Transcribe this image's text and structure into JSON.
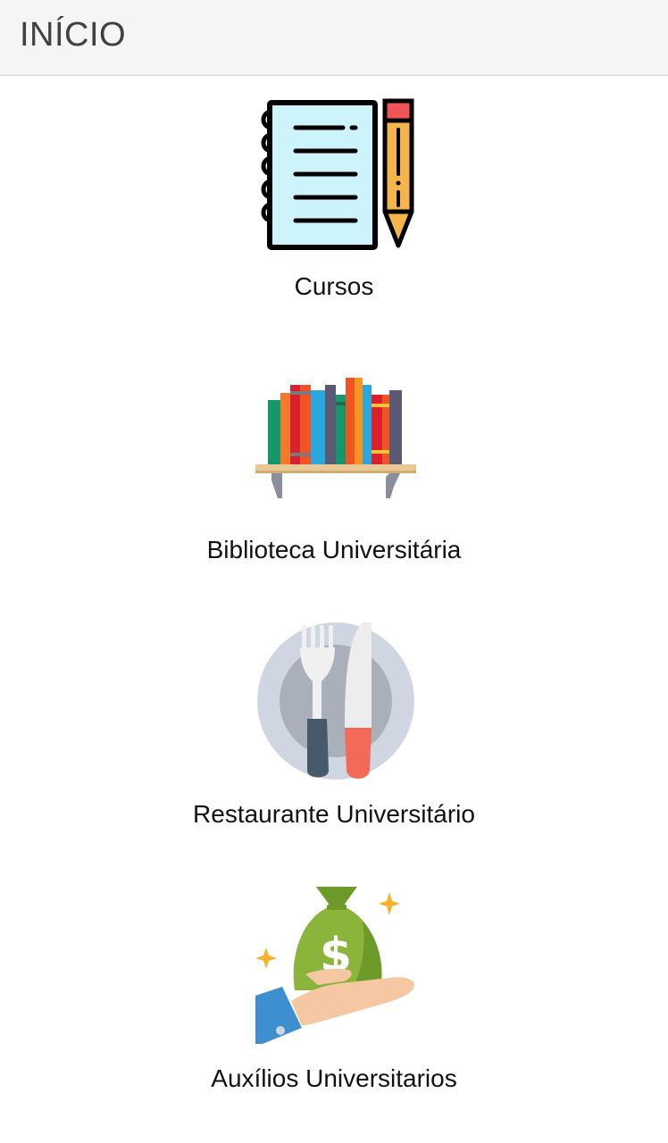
{
  "appbar": {
    "title": "INÍCIO"
  },
  "menu": {
    "items": [
      {
        "label": "Cursos",
        "icon": "notebook-pencil-icon"
      },
      {
        "label": "Biblioteca Universitária",
        "icon": "bookshelf-icon"
      },
      {
        "label": "Restaurante Universitário",
        "icon": "plate-fork-knife-icon"
      },
      {
        "label": "Auxílios Universitarios",
        "icon": "money-bag-hand-icon"
      }
    ]
  },
  "colors": {
    "appbar_bg": "#f5f5f5",
    "title_text": "#404040",
    "label_text": "#111111"
  }
}
